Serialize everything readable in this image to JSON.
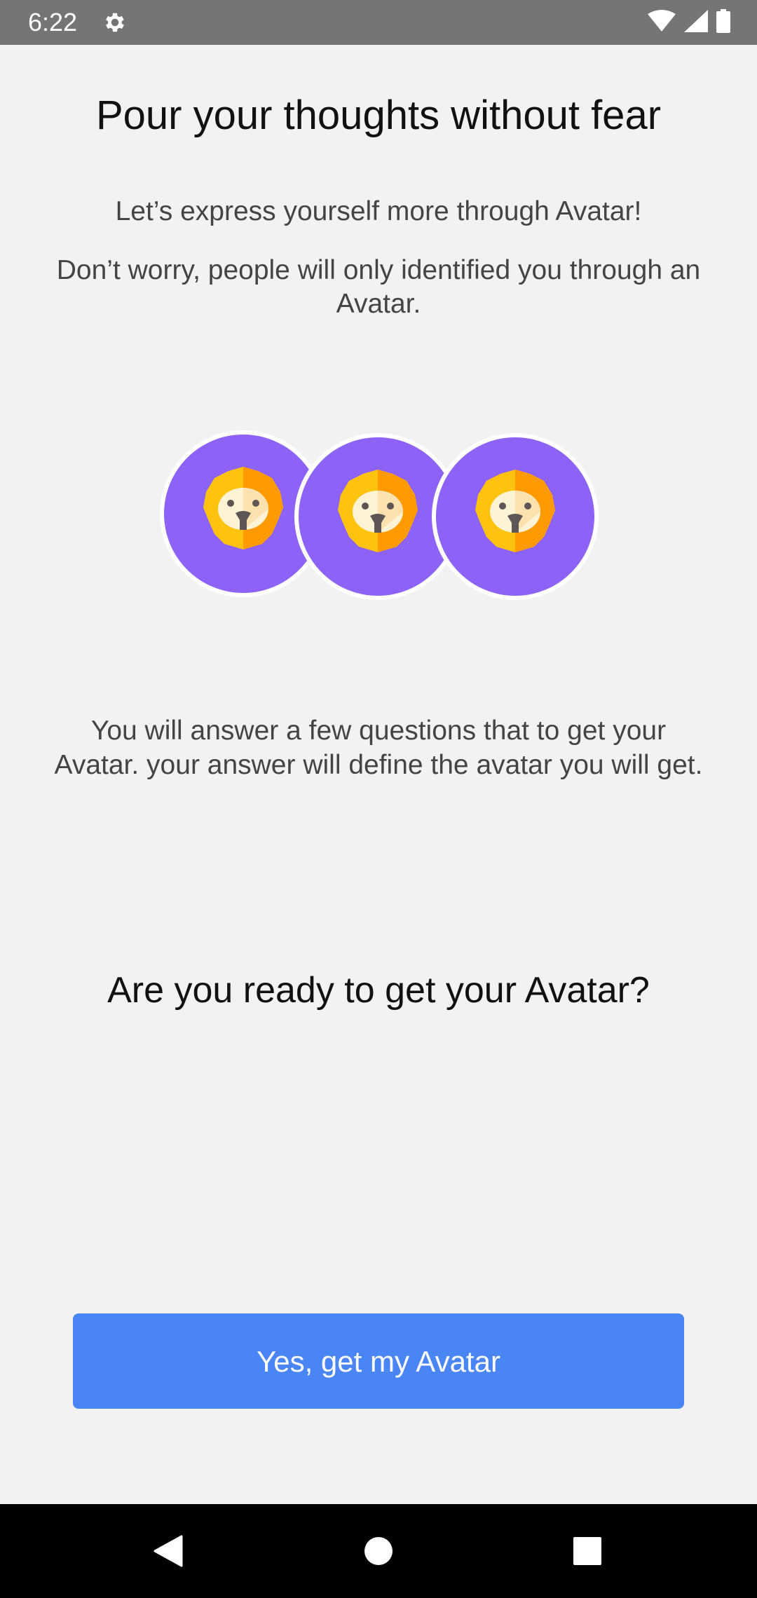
{
  "status_bar": {
    "time": "6:22",
    "icons": [
      "gear-icon",
      "wifi-icon",
      "signal-icon",
      "battery-icon"
    ]
  },
  "intro": {
    "title": "Pour your thoughts without fear",
    "subtitle": "Let’s express yourself more through Avatar!",
    "reassurance": "Don’t worry, people will only identified you through an Avatar."
  },
  "avatars": {
    "icon": "lion-face-icon",
    "count": 3,
    "background_color": "#8c63f6"
  },
  "explanation": "You will answer a few questions that to get your Avatar. your answer will define the avatar you will get.",
  "question": "Are you ready to get your Avatar?",
  "cta": {
    "label": "Yes, get my Avatar",
    "color": "#4a85f5"
  },
  "nav_bar": {
    "icons": [
      "back-icon",
      "home-icon",
      "recents-icon"
    ]
  }
}
